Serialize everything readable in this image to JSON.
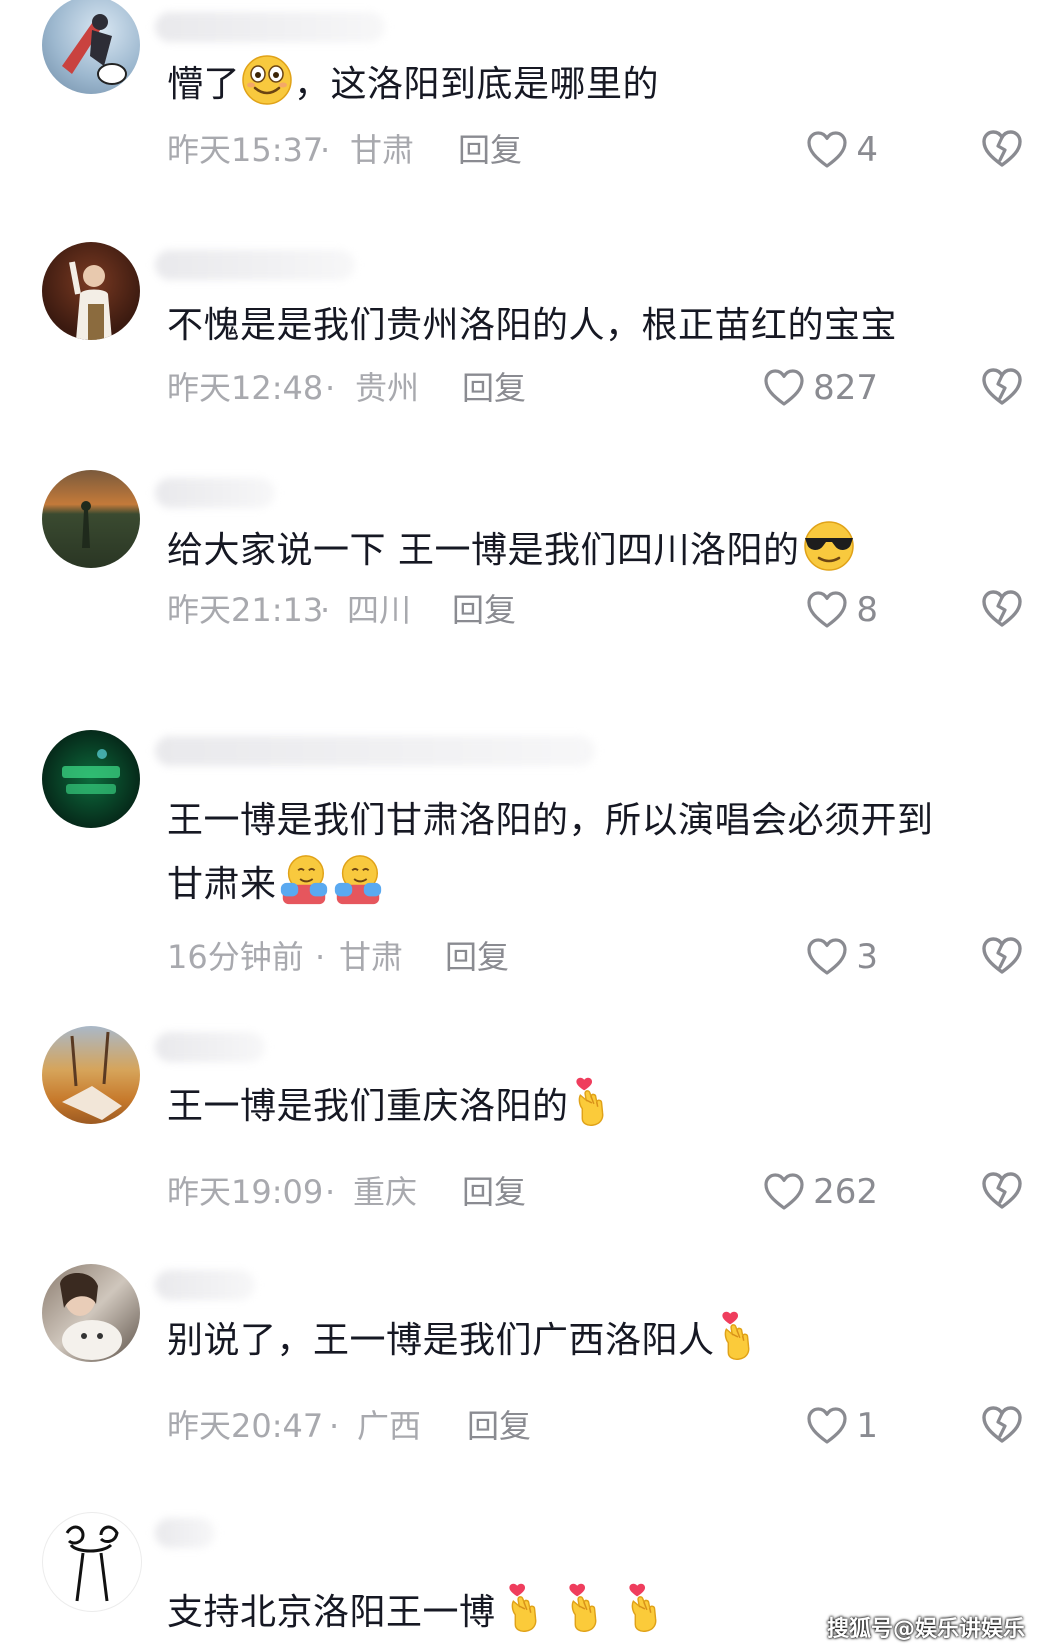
{
  "comments": [
    {
      "text": "懵了",
      "text_after": "，这洛阳到底是哪里的",
      "time": "昨天15:37",
      "location": "甘肃",
      "reply": "回复",
      "likes": "4"
    },
    {
      "text": "不愧是是我们贵州洛阳的人，根正苗红的宝宝",
      "time": "昨天12:48",
      "location": "贵州",
      "reply": "回复",
      "likes": "827"
    },
    {
      "text": "给大家说一下 王一博是我们四川洛阳的",
      "time": "昨天21:13",
      "location": "四川",
      "reply": "回复",
      "likes": "8"
    },
    {
      "text": "王一博是我们甘肃洛阳的，所以演唱会必须开到",
      "text_line2": "甘肃来",
      "time": "16分钟前",
      "location": "甘肃",
      "reply": "回复",
      "likes": "3"
    },
    {
      "text": "王一博是我们重庆洛阳的",
      "time": "昨天19:09",
      "location": "重庆",
      "reply": "回复",
      "likes": "262"
    },
    {
      "text": "别说了，王一博是我们广西洛阳人",
      "time": "昨天20:47",
      "location": "广西",
      "reply": "回复",
      "likes": "1"
    },
    {
      "text": "支持北京洛阳王一博"
    }
  ],
  "separator": "·",
  "watermark": "搜狐号@娱乐讲娱乐",
  "icons": {
    "like": "heart-outline-icon",
    "dislike": "broken-heart-icon"
  },
  "colors": {
    "text": "#161823",
    "meta": "#a8a9ae",
    "icon": "#8a8b91"
  }
}
